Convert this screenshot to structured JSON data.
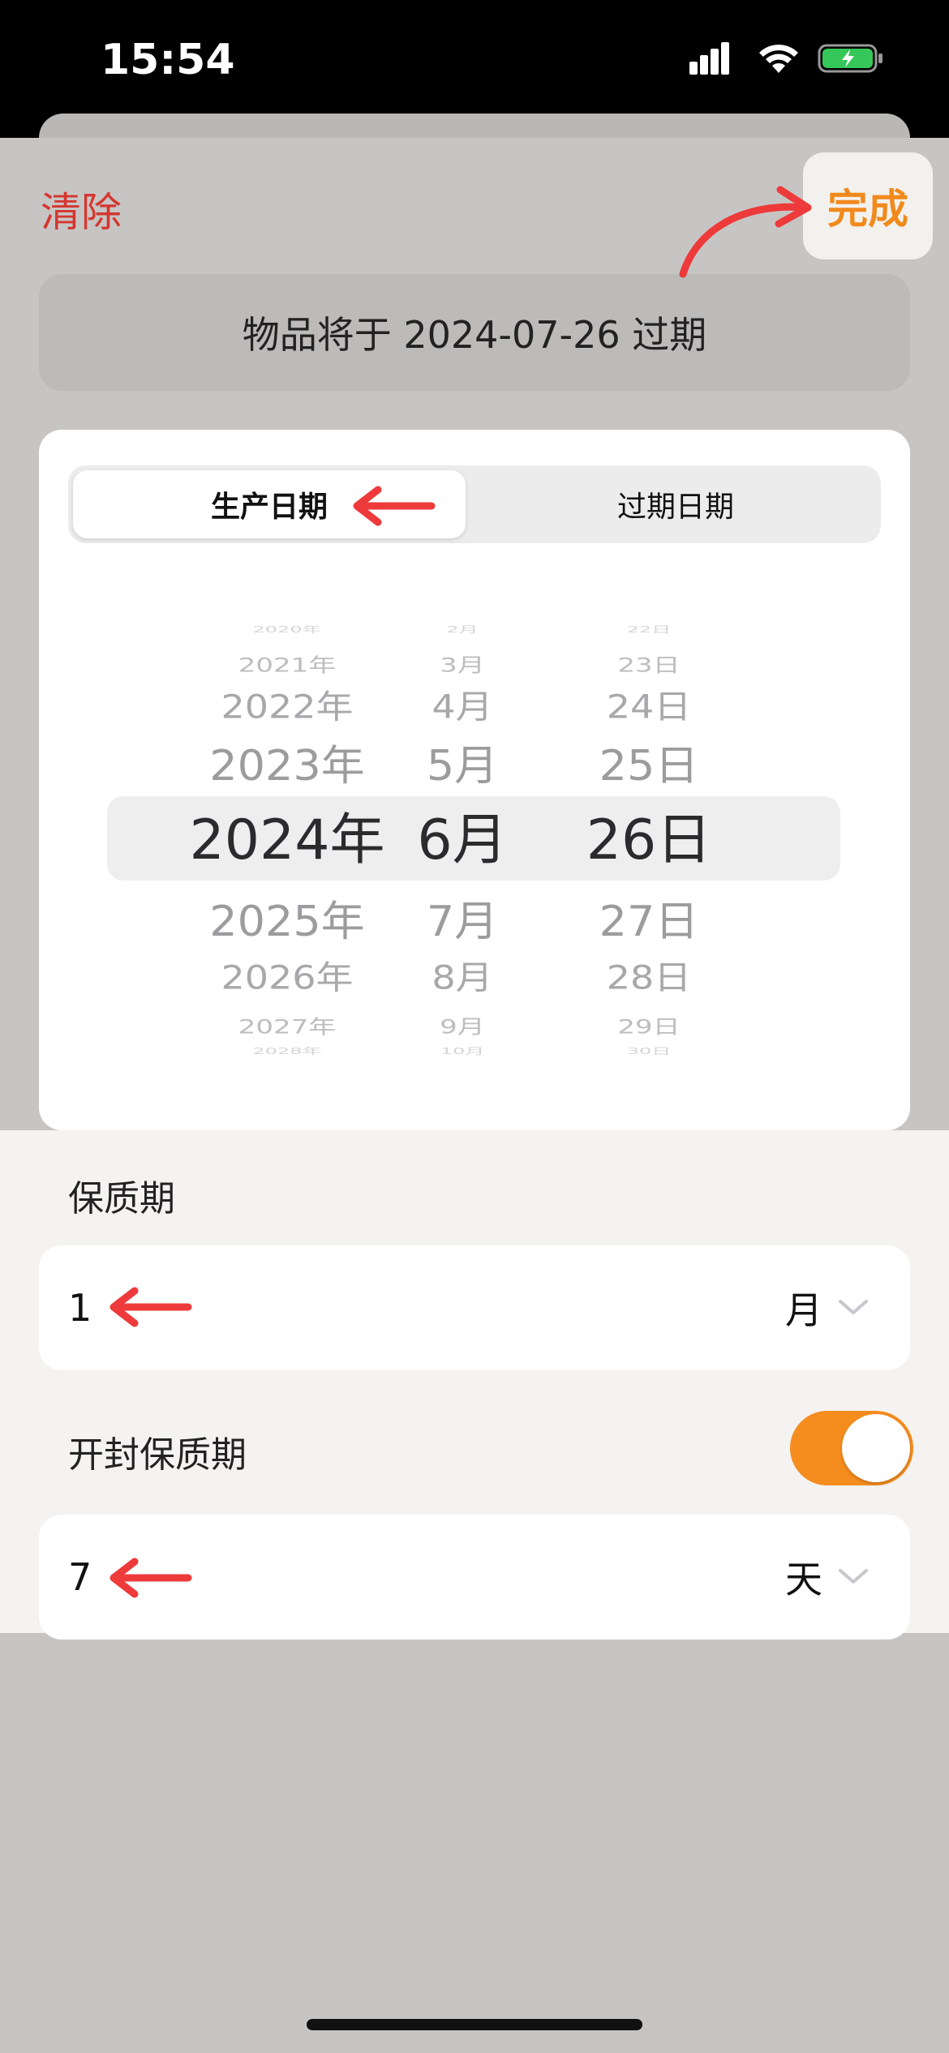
{
  "status_bar": {
    "time": "15:54"
  },
  "header": {
    "clear_label": "清除",
    "done_label": "完成"
  },
  "expiry_banner": {
    "text": "物品将于 2024-07-26 过期"
  },
  "segment": {
    "active_label": "生产日期",
    "inactive_label": "过期日期"
  },
  "date_picker": {
    "years": [
      "2020年",
      "2021年",
      "2022年",
      "2023年",
      "2024年",
      "2025年",
      "2026年",
      "2027年",
      "2028年"
    ],
    "months": [
      "2月",
      "3月",
      "4月",
      "5月",
      "6月",
      "7月",
      "8月",
      "9月",
      "10月"
    ],
    "days": [
      "22日",
      "23日",
      "24日",
      "25日",
      "26日",
      "27日",
      "28日",
      "29日",
      "30日"
    ],
    "selected": {
      "year": "2024年",
      "month": "6月",
      "day": "26日"
    }
  },
  "shelf_life": {
    "label": "保质期",
    "value": "1",
    "unit": "月"
  },
  "opened_shelf_life": {
    "label": "开封保质期",
    "enabled": true,
    "value": "7",
    "unit": "天"
  },
  "colors": {
    "accent": "#f58c1e",
    "destructive": "#d5362f",
    "annotation": "#ee3a3a"
  },
  "icons": [
    "signal-icon",
    "wifi-icon",
    "battery-charging-icon",
    "chevron-down-icon"
  ]
}
